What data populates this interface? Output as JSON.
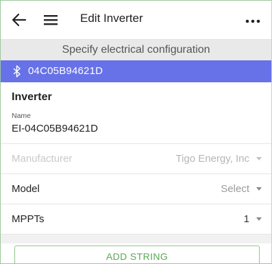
{
  "topbar": {
    "title": "Edit Inverter",
    "back_icon": "arrow-left-icon",
    "menu_icon": "hamburger-menu-icon",
    "more_icon": "more-horizontal-icon"
  },
  "subheader": "Specify electrical configuration",
  "device": {
    "icon": "bluetooth-icon",
    "id": "04C05B94621D",
    "bar_color": "#6772e8"
  },
  "inverter": {
    "section_title": "Inverter",
    "name_label": "Name",
    "name_value": "EI-04C05B94621D"
  },
  "fields": [
    {
      "label": "Manufacturer",
      "value": "Tigo Energy, Inc",
      "disabled": true
    },
    {
      "label": "Model",
      "value": "Select",
      "disabled": false
    },
    {
      "label": "MPPTs",
      "value": "1",
      "disabled": false
    }
  ],
  "actions": {
    "add_string_label": "ADD STRING",
    "accent_color": "#58a858"
  }
}
